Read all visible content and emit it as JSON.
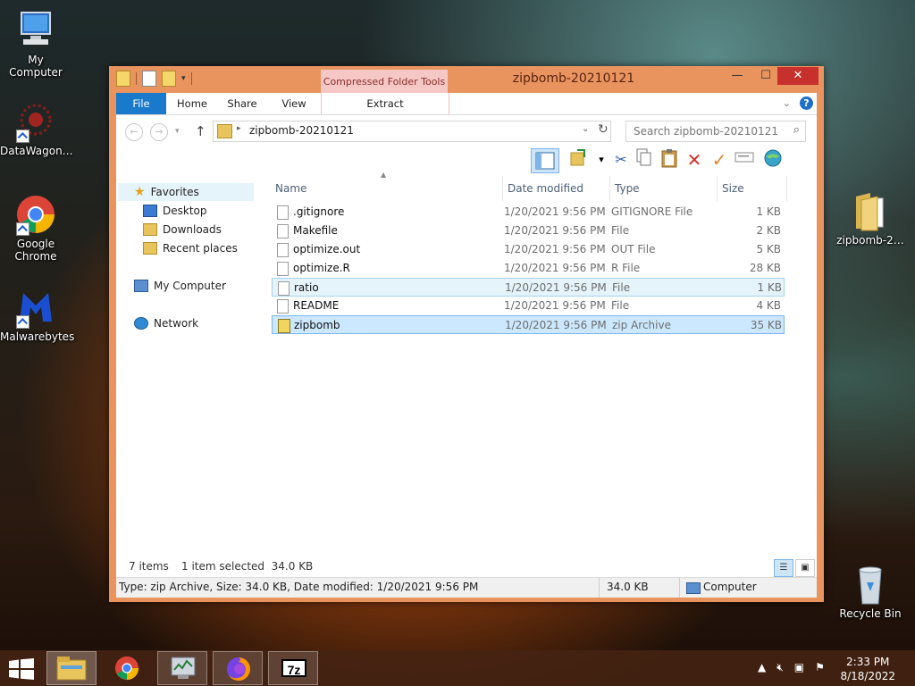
{
  "desktop": {
    "icons": [
      {
        "label": "My Computer",
        "icon": "my-computer-icon"
      },
      {
        "label": "DataWagon…",
        "icon": "datawagon-icon"
      },
      {
        "label": "Google Chrome",
        "icon": "chrome-icon"
      },
      {
        "label": "Malwarebytes",
        "icon": "malwarebytes-icon"
      },
      {
        "label": "zipbomb-2…",
        "icon": "folder-icon"
      },
      {
        "label": "Recycle Bin",
        "icon": "recycle-bin-icon"
      }
    ]
  },
  "window": {
    "title": "zipbomb-20210121",
    "context_tab": "Compressed Folder Tools",
    "controls": {
      "minimize": "—",
      "maximize": "☐",
      "close": "✕"
    },
    "ribbon_tabs": {
      "file": "File",
      "home": "Home",
      "share": "Share",
      "view": "View",
      "extract": "Extract"
    },
    "help": "?"
  },
  "address": {
    "path": "zipbomb-20210121",
    "search_placeholder": "Search zipbomb-20210121"
  },
  "nav_pane": {
    "favorites": "Favorites",
    "desktop": "Desktop",
    "downloads": "Downloads",
    "recent": "Recent places",
    "computer": "My Computer",
    "network": "Network"
  },
  "file_list": {
    "headers": {
      "name": "Name",
      "date": "Date modified",
      "type": "Type",
      "size": "Size"
    },
    "rows": [
      {
        "name": ".gitignore",
        "date": "1/20/2021 9:56 PM",
        "type": "GITIGNORE File",
        "size": "1 KB"
      },
      {
        "name": "Makefile",
        "date": "1/20/2021 9:56 PM",
        "type": "File",
        "size": "2 KB"
      },
      {
        "name": "optimize.out",
        "date": "1/20/2021 9:56 PM",
        "type": "OUT File",
        "size": "5 KB"
      },
      {
        "name": "optimize.R",
        "date": "1/20/2021 9:56 PM",
        "type": "R File",
        "size": "28 KB"
      },
      {
        "name": "ratio",
        "date": "1/20/2021 9:56 PM",
        "type": "File",
        "size": "1 KB"
      },
      {
        "name": "README",
        "date": "1/20/2021 9:56 PM",
        "type": "File",
        "size": "4 KB"
      },
      {
        "name": "zipbomb",
        "date": "1/20/2021 9:56 PM",
        "type": "zip Archive",
        "size": "35 KB"
      }
    ]
  },
  "status": {
    "items": "7 items",
    "selected": "1 item selected  34.0 KB",
    "details": "Type: zip Archive, Size: 34.0 KB, Date modified: 1/20/2021 9:56 PM",
    "details_size": "34.0 KB",
    "location": "Computer"
  },
  "taskbar": {
    "time": "2:33 PM",
    "date": "8/18/2022",
    "apps": [
      "start-button",
      "file-explorer",
      "chrome",
      "task-manager",
      "firefox",
      "7zip"
    ],
    "sevenzip_label": "7z"
  },
  "colors": {
    "window_frame": "#e9945f",
    "close_button": "#c7302c",
    "file_tab": "#1979ca",
    "context_tab": "#f5c8c6",
    "selection": "#cce8ff"
  }
}
